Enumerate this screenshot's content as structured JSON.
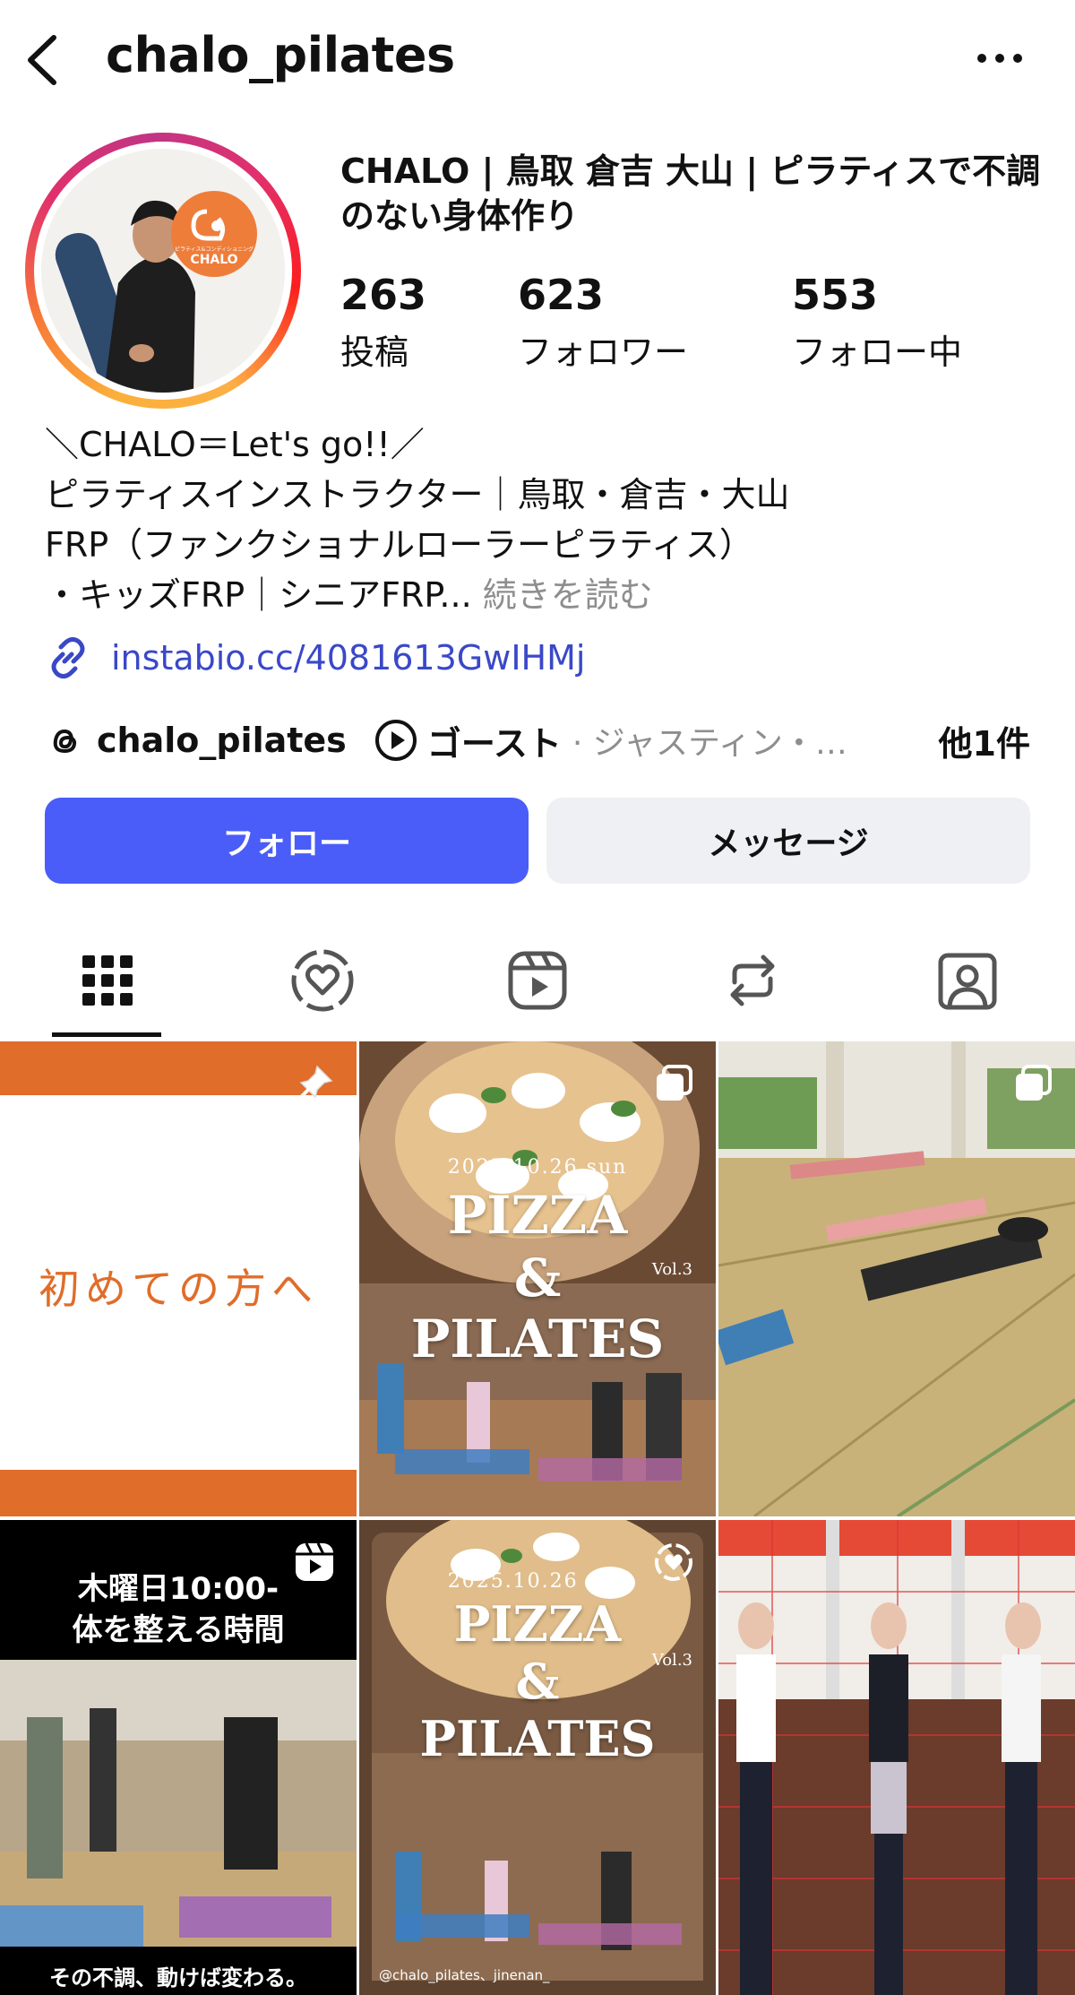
{
  "header": {
    "username": "chalo_pilates"
  },
  "profile": {
    "full_name": "CHALO | 鳥取 倉吉 大山 | ピラティスで不調のない身体作り",
    "avatar_text": "CHALO",
    "avatar_subtext": "ピラティス&コンディショニング",
    "stats": [
      {
        "value": "263",
        "label": "投稿"
      },
      {
        "value": "623",
        "label": "フォロワー"
      },
      {
        "value": "553",
        "label": "フォロー中"
      }
    ],
    "bio_lines": [
      "＼CHALO＝Let's go!!／",
      "ピラティスインストラクター｜鳥取・倉吉・大山",
      "FRP（ファンクショナルローラーピラティス）",
      "・キッズFRP｜シニアFRP..."
    ],
    "read_more": "続きを読む",
    "link": "instabio.cc/4081613GwIHMj",
    "threads_handle": "chalo_pilates",
    "music_title": "ゴースト",
    "music_artist": "· ジャスティン・…",
    "others": "他1件"
  },
  "actions": {
    "follow": "フォロー",
    "message": "メッセージ"
  },
  "tabs": [
    {
      "icon": "grid-icon",
      "active": true
    },
    {
      "icon": "collab-heart-icon",
      "active": false
    },
    {
      "icon": "reels-icon",
      "active": false
    },
    {
      "icon": "repost-icon",
      "active": false
    },
    {
      "icon": "tagged-icon",
      "active": false
    }
  ],
  "posts": {
    "p1": {
      "text": "初めての方へ",
      "badge": "pin-icon"
    },
    "p2": {
      "date": "2025.10.26 sun",
      "line1": "PIZZA",
      "line2": "&",
      "line3": "PILATES",
      "vol": "Vol.3",
      "badge": "carousel-icon"
    },
    "p3": {
      "badge": "carousel-icon"
    },
    "p4": {
      "line1": "木曜日10:00-",
      "line2": "体を整える時間",
      "footer": "その不調、動けば変わる。",
      "badge": "reels-icon"
    },
    "p5": {
      "date": "2025.10.26 sun",
      "line1": "PIZZA",
      "line2": "&",
      "line3": "PILATES",
      "vol": "Vol.3",
      "caption": "@chalo_pilates、jinenan_",
      "badge": "collab-icon"
    },
    "p6": {}
  },
  "colors": {
    "follow_button": "#4a5df9",
    "link": "#3a48c8",
    "brand_orange": "#e06d2a"
  }
}
